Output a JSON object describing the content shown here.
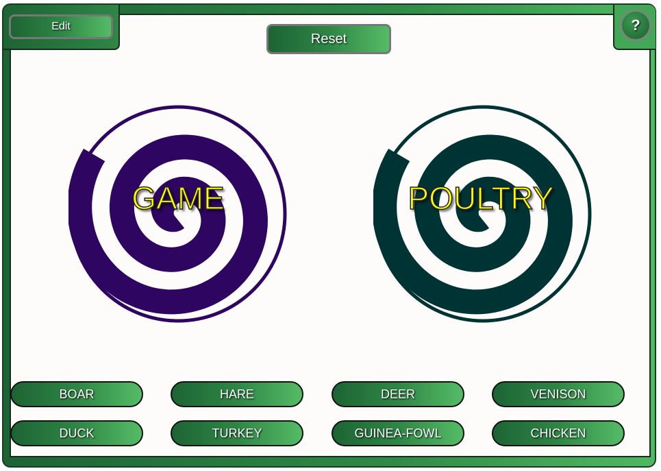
{
  "toolbar": {
    "edit_label": "Edit",
    "reset_label": "Reset",
    "help_label": "?"
  },
  "categories": [
    {
      "label": "GAME",
      "color": "#2e0560"
    },
    {
      "label": "POULTRY",
      "color": "#003333"
    }
  ],
  "items": [
    "BOAR",
    "HARE",
    "DEER",
    "VENISON",
    "DUCK",
    "TURKEY",
    "GUINEA-FOWL",
    "CHICKEN"
  ],
  "colors": {
    "button_green": "#2e8645",
    "label_yellow": "#ffff00"
  }
}
